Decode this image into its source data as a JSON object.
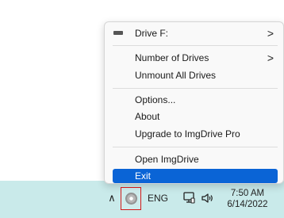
{
  "menu": {
    "drive": {
      "label": "Drive F:",
      "icon": "drive-icon"
    },
    "number_of_drives": {
      "label": "Number of Drives"
    },
    "unmount_all": {
      "label": "Unmount All Drives"
    },
    "options": {
      "label": "Options..."
    },
    "about": {
      "label": "About"
    },
    "upgrade": {
      "label": "Upgrade to ImgDrive Pro"
    },
    "open": {
      "label": "Open ImgDrive"
    },
    "exit": {
      "label": "Exit"
    },
    "submenu_chevron": ">"
  },
  "taskbar": {
    "show_hidden_icons": "∧",
    "tray_icon": "imgdrive-disc-icon",
    "language": "ENG",
    "network_icon": "network-icon",
    "volume_icon": "volume-icon",
    "time": "7:50 AM",
    "date": "6/14/2022"
  },
  "colors": {
    "highlight": "#0a64d6",
    "desktop": "#c9eaea",
    "tray_outline": "#d11919"
  }
}
